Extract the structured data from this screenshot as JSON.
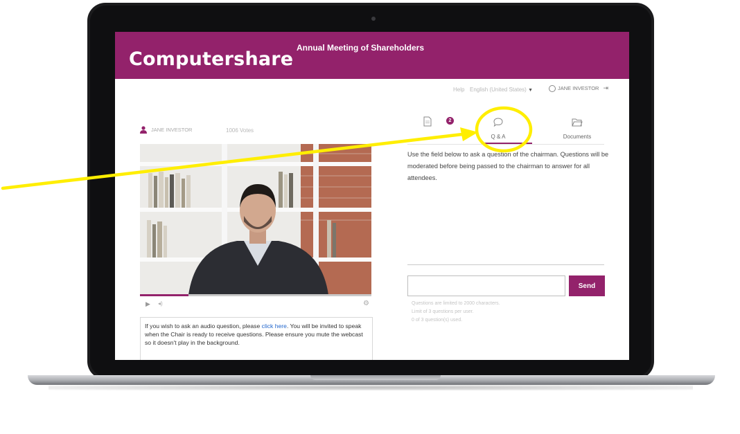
{
  "header": {
    "logo_text": "Computershare",
    "event_title": "Annual Meeting of Shareholders"
  },
  "topbar": {
    "help_label": "Help",
    "language_label": "English (United States)",
    "user_name": "JANE INVESTOR"
  },
  "viewer": {
    "user_name": "JANE INVESTOR",
    "votes_label": "1006 Votes",
    "progress_fraction": 0.21
  },
  "audio_notice": {
    "before_link": "If you wish to ask an audio question, please ",
    "link_text": "click here",
    "after_link": ". You will be invited to speak when the Chair is ready to receive questions. Please ensure you mute the webcast so it doesn't play in the background."
  },
  "tabs": {
    "agenda_badge": "2",
    "qa_label": "Q & A",
    "documents_label": "Documents",
    "active": "qa"
  },
  "qa": {
    "instructions": "Use the field below to ask a question of the chairman. Questions will be moderated before being passed to the chairman to answer for all attendees.",
    "input_value": "",
    "send_label": "Send",
    "limit_chars": "Questions are limited to 2000 characters.",
    "limit_per_user": "Limit of 3 questions per user.",
    "used_count": "0 of 3 question(s) used."
  },
  "colors": {
    "brand": "#93226b",
    "annotation": "#ffee00",
    "laptop_bezel": "#1b1b1d"
  },
  "icons": {
    "agenda_tab": "document-icon",
    "qa_tab": "speech-bubble-icon",
    "documents_tab": "folder-icon",
    "user": "person-icon",
    "logout": "logout-icon",
    "play": "play-icon",
    "volume": "volume-icon",
    "settings": "gear-icon"
  }
}
